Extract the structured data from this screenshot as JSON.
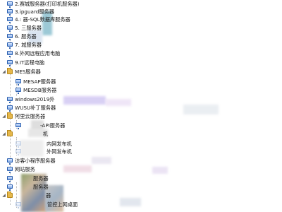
{
  "tree": {
    "items": [
      {
        "label": "2.赛城服务器(打印机服务器)"
      },
      {
        "label": "3.ipguard服务器"
      },
      {
        "label": "4.:   器-SQL数据库服务器"
      },
      {
        "label": "5.    三服务器"
      },
      {
        "label": "6.     服务器"
      },
      {
        "label": "7.      城服务器"
      },
      {
        "label": "8.外网远程应用电脑"
      },
      {
        "label": "9.IT远程电脑"
      },
      {
        "label": "MES服务器"
      },
      {
        "label": "MESAP服务器"
      },
      {
        "label": "MESDB服务器"
      },
      {
        "label": "windows2019外"
      },
      {
        "label": "WUSU补丁服务器"
      },
      {
        "label": "阿里云服务器"
      },
      {
        "label": "-API服务器"
      },
      {
        "label": "机"
      },
      {
        "label": "内网发布机"
      },
      {
        "label": "外网发布机"
      },
      {
        "label": "访客小程序服务器"
      },
      {
        "label": "网站服务"
      },
      {
        "label": "服务器"
      },
      {
        "label": "服务器"
      },
      {
        "label": "器"
      },
      {
        "label": "管控上网桌面"
      }
    ]
  },
  "icons": {
    "computer": "computer-icon",
    "folder": "folder-icon",
    "expand": "expand-arrow-icon",
    "collapse": "collapse-arrow-icon"
  },
  "colors": {
    "icon_blue": "#2b5fae",
    "folder_yellow": "#e6b84b"
  }
}
